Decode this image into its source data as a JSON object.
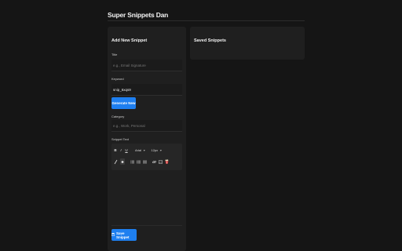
{
  "app": {
    "title": "Super Snippets Dan"
  },
  "add_panel": {
    "heading": "Add New Snippet",
    "title_label": "Title",
    "title_placeholder": "e.g., Email Signature",
    "keyword_label": "Keyword",
    "keyword_value": "snip_6xqs9",
    "generate_label": "Generate New",
    "category_label": "Category",
    "category_placeholder": "e.g., Work, Personal",
    "snippet_label": "Snippet Text",
    "toolbar": {
      "bold": "B",
      "italic": "I",
      "underline": "U",
      "font_value": "Arial",
      "size_value": "12px",
      "pen_icon": "pen-icon",
      "color_icon": "text-color-icon",
      "list_ul_icon": "list-bullets-icon",
      "list_ol_icon": "list-numbers-icon",
      "align_icon": "align-icon",
      "link_icon": "link-icon",
      "image_icon": "image-icon",
      "emoji_icon": "popcorn-icon"
    },
    "save_label": "Save Snippet"
  },
  "saved_panel": {
    "heading": "Saved Snippets"
  }
}
